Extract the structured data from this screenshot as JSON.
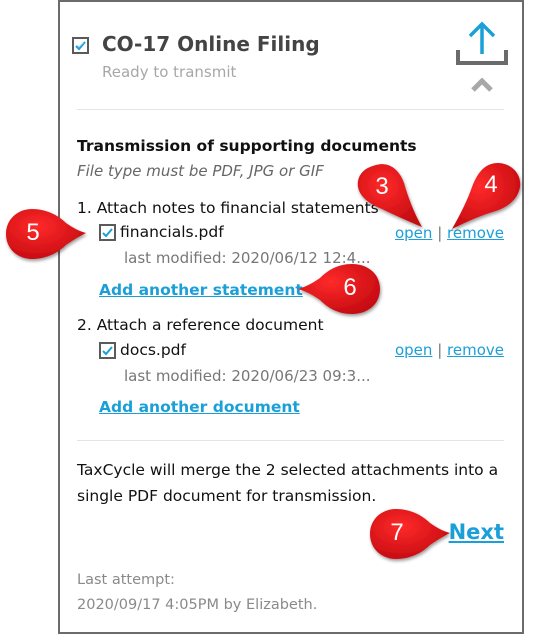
{
  "header": {
    "checked": true,
    "title": "CO-17 Online Filing",
    "status": "Ready to transmit",
    "upload_icon": "upload-icon",
    "collapse_icon": "chevron-up-icon"
  },
  "section": {
    "title": "Transmission of supporting documents",
    "hint": "File type must be PDF, JPG or GIF"
  },
  "items": [
    {
      "label": "1.  Attach notes to financial statements",
      "file": "financials.pdf",
      "checked": true,
      "modified": "last modified: 2020/06/12 12:4...",
      "open_label": "open",
      "separator": "|",
      "remove_label": "remove",
      "add_label": "Add another statement"
    },
    {
      "label": "2.  Attach a reference document",
      "file": "docs.pdf",
      "checked": true,
      "modified": "last modified: 2020/06/23 09:3...",
      "open_label": "open",
      "separator": "|",
      "remove_label": "remove",
      "add_label": "Add another document"
    }
  ],
  "merge_text": "TaxCycle will merge the 2 selected attachments into a single PDF document for transmission.",
  "next_label": "Next",
  "last_attempt": {
    "label": "Last attempt:",
    "value": "2020/09/17 4:05PM by Elizabeth."
  },
  "callouts": [
    "3",
    "4",
    "5",
    "6",
    "7"
  ],
  "colors": {
    "accent": "#1a9fd8",
    "callout": "#e3141b",
    "border": "#6b6b6b"
  }
}
